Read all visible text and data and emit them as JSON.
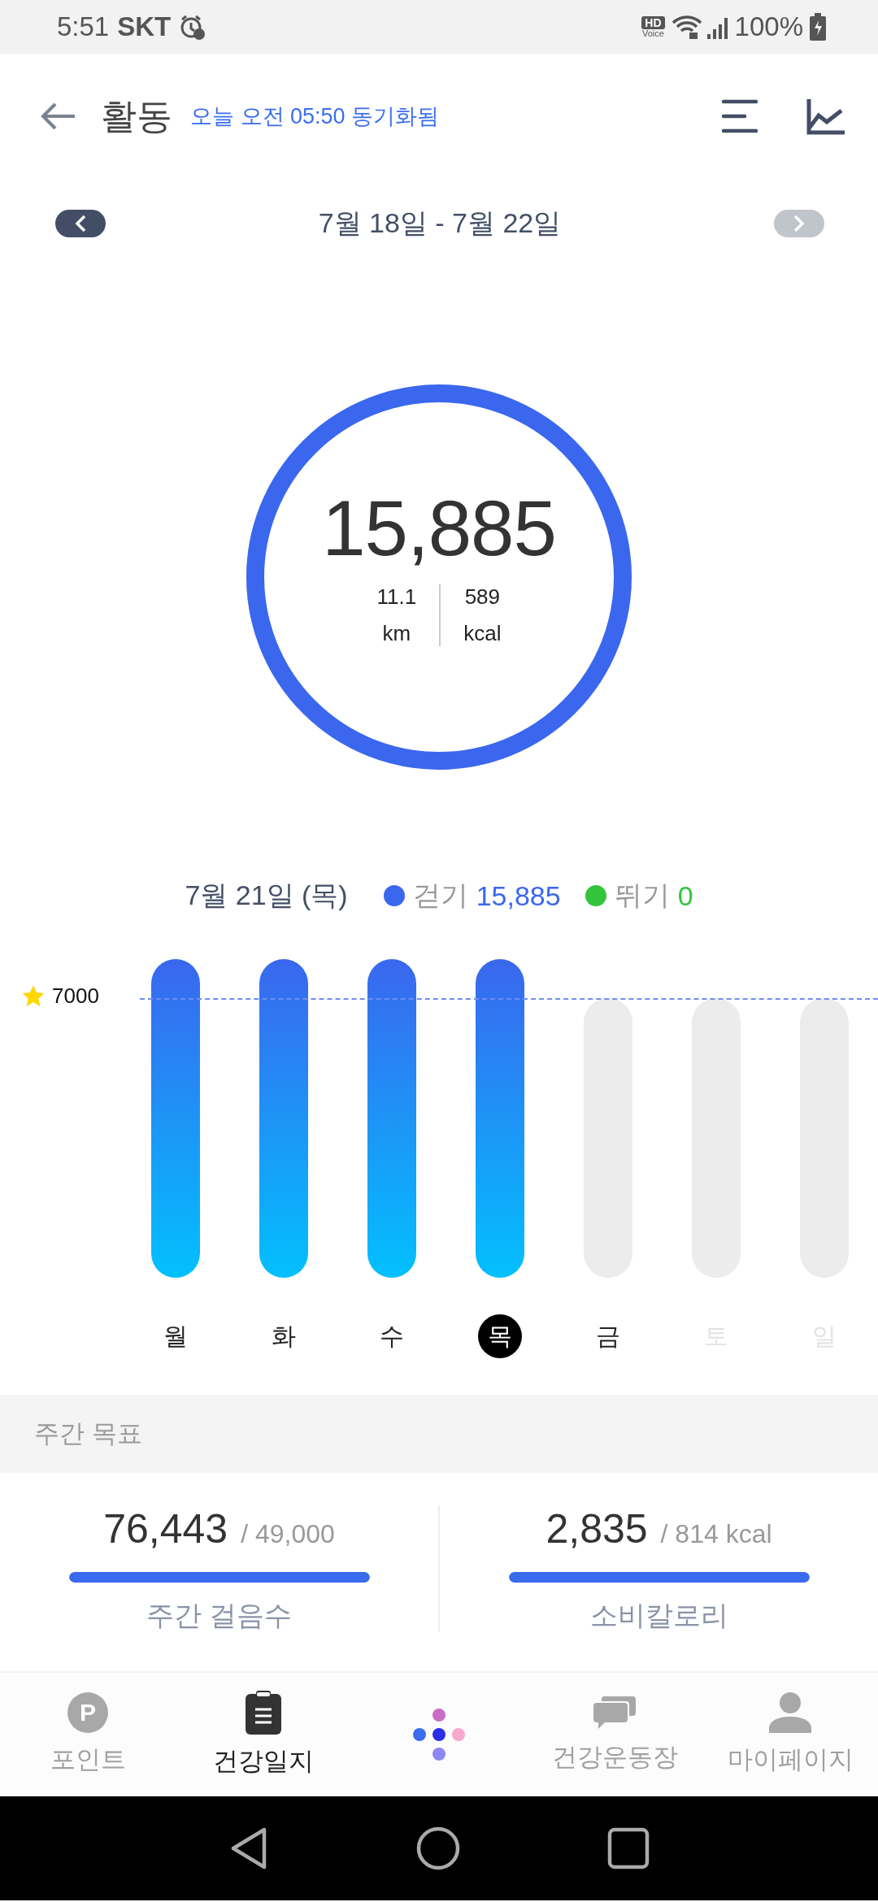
{
  "status_bar": {
    "time": "5:51",
    "carrier": "SKT",
    "hd_top": "HD",
    "hd_bottom": "Voice",
    "battery": "100%"
  },
  "header": {
    "title": "활동",
    "sync": "오늘 오전 05:50 동기화됨"
  },
  "date_nav": {
    "range": "7월 18일 - 7월 22일",
    "prev_disabled": false,
    "next_disabled": true
  },
  "summary": {
    "steps": "15,885",
    "level": 1,
    "distance": "11.1",
    "distance_unit": "km",
    "calories": "589",
    "calories_unit": "kcal"
  },
  "day_legend": {
    "date": "7월 21일 (목)",
    "items": [
      {
        "label": "걷기",
        "value": "15,885",
        "color": "#3a67ee"
      },
      {
        "label": "뛰기",
        "value": "0",
        "color": "#34c43c"
      }
    ]
  },
  "chart": {
    "goal": "7000",
    "days": [
      {
        "label": "월",
        "kind": "filled",
        "selected": false,
        "disabled": false
      },
      {
        "label": "화",
        "kind": "filled",
        "selected": false,
        "disabled": false
      },
      {
        "label": "수",
        "kind": "filled",
        "selected": false,
        "disabled": false
      },
      {
        "label": "목",
        "kind": "filled",
        "selected": true,
        "disabled": false
      },
      {
        "label": "금",
        "kind": "empty",
        "selected": false,
        "disabled": false
      },
      {
        "label": "토",
        "kind": "empty",
        "selected": false,
        "disabled": true
      },
      {
        "label": "일",
        "kind": "empty",
        "selected": false,
        "disabled": true
      }
    ]
  },
  "weekly_goal": {
    "title": "주간 목표",
    "stats": [
      {
        "value": "76,443",
        "target": "/ 49,000",
        "label": "주간 걸음수",
        "level": 1
      },
      {
        "value": "2,835",
        "target": "/ 814 kcal",
        "label": "소비칼로리",
        "level": 1
      }
    ]
  },
  "bottom_nav": [
    {
      "label": "포인트",
      "selected": false,
      "icon_text": "P"
    },
    {
      "label": "건강일지",
      "selected": true
    },
    {
      "label": "건강운동장",
      "selected": false
    },
    {
      "label": "마이페이지",
      "selected": false
    }
  ]
}
